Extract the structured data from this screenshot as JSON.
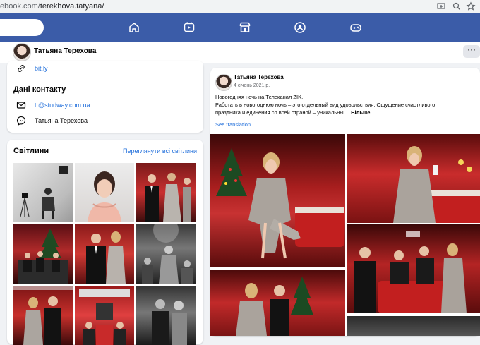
{
  "browser": {
    "url_dim": "ebook.com/",
    "url_path": "terekhova.tatyana/"
  },
  "nav": {
    "icons": [
      "home-icon",
      "watch-icon",
      "marketplace-icon",
      "groups-icon",
      "gaming-icon"
    ]
  },
  "profile": {
    "name": "Татьяна Терехова",
    "more_label": "···"
  },
  "contacts": {
    "link": "bit.ly",
    "section_title": "Дані контакту",
    "email": "tt@studway.com.ua",
    "messenger": "Татьяна Терехова"
  },
  "photos": {
    "title": "Світлини",
    "see_all": "Переглянути всі світлини"
  },
  "post": {
    "author": "Татьяна Терехова",
    "date": "4 січень 2021 р. ·",
    "line1": "Новогодняя ночь на Телеканал ZIK.",
    "line2": "Работать в новогоднюю ночь – это отдельный вид удовольствия. Ощущение счастливого",
    "line3": "праздника и единения со всей страной – уникальны ...",
    "more": "Більше",
    "see_translation": "See translation"
  },
  "colors": {
    "nav_blue": "#3b5ca8",
    "link_blue": "#216fdb",
    "bg": "#f0f2f5"
  }
}
